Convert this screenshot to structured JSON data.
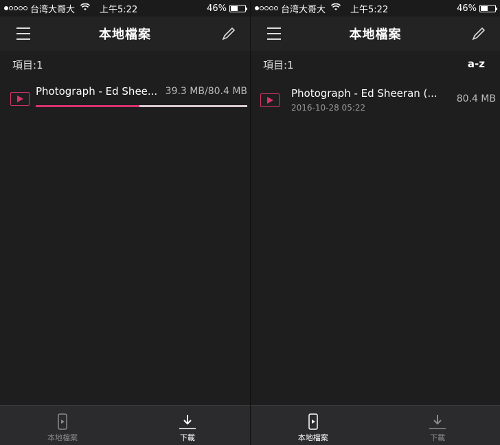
{
  "status_bar": {
    "carrier": "台湾大哥大",
    "time": "上午5:22",
    "battery": "46%",
    "battery_level": 0.46,
    "signal_icon": "signal-dots-icon",
    "wifi_icon": "wifi-icon"
  },
  "left_screen": {
    "nav_title": "本地檔案",
    "menu_icon": "hamburger-menu-icon",
    "edit_icon": "pencil-icon",
    "count_label": "項目:1",
    "item": {
      "title": "Photograph - Ed Shee...",
      "size": "39.3 MB/80.4 MB",
      "progress": 0.49,
      "icon": "video-file-icon"
    },
    "tabs": [
      {
        "label": "本地檔案",
        "icon": "phone-video-icon",
        "active": false
      },
      {
        "label": "下載",
        "icon": "download-icon",
        "active": true
      }
    ]
  },
  "right_screen": {
    "nav_title": "本地檔案",
    "menu_icon": "hamburger-menu-icon",
    "edit_icon": "pencil-icon",
    "count_label": "項目:1",
    "sort_label": "a-z",
    "item": {
      "title": "Photograph - Ed Sheeran (...",
      "date": "2016-10-28 05:22",
      "size": "80.4 MB",
      "icon": "video-file-icon"
    },
    "tabs": [
      {
        "label": "本地檔案",
        "icon": "phone-video-icon",
        "active": true
      },
      {
        "label": "下載",
        "icon": "download-icon",
        "active": false
      }
    ]
  },
  "colors": {
    "accent": "#d6336c",
    "background": "#1e1e1f",
    "navbar": "#232324",
    "tabbar": "#2b2b2d"
  }
}
